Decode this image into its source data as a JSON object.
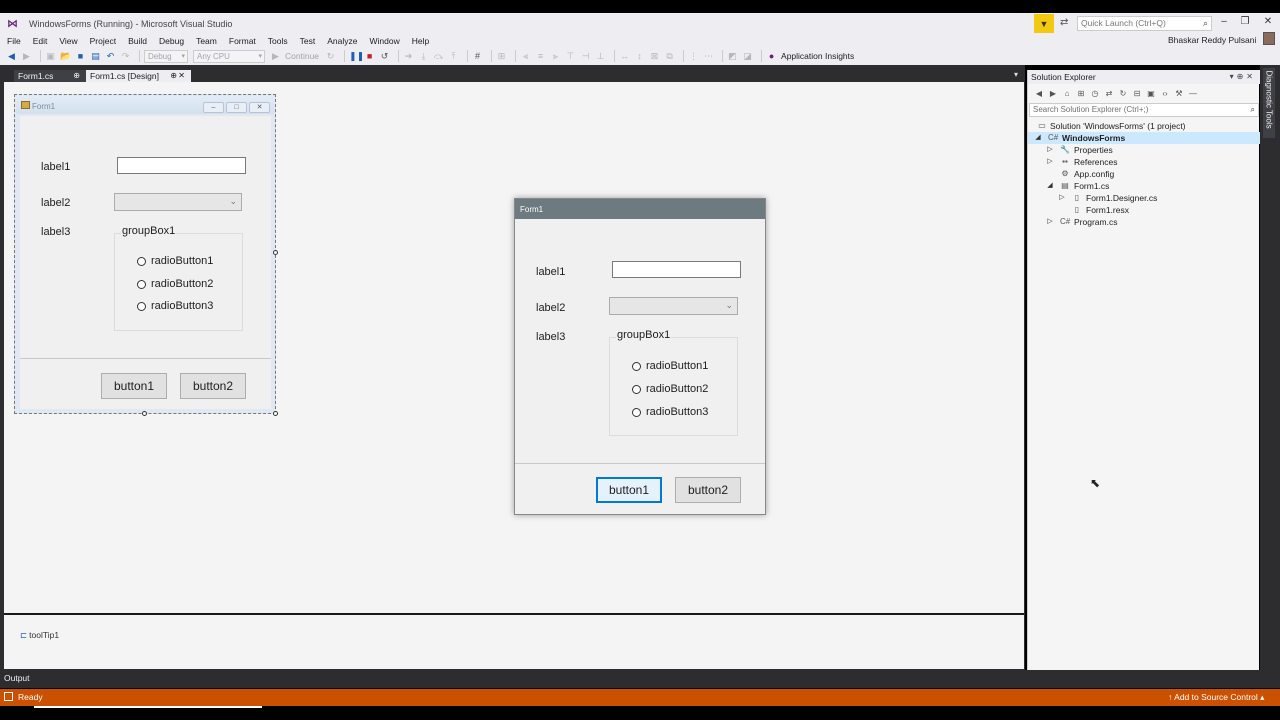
{
  "window": {
    "title": "WindowsForms (Running) - Microsoft Visual Studio",
    "quick_launch_placeholder": "Quick Launch (Ctrl+Q)",
    "user_name": "Bhaskar Reddy Pulsani"
  },
  "menu": [
    "File",
    "Edit",
    "View",
    "Project",
    "Build",
    "Debug",
    "Team",
    "Format",
    "Tools",
    "Test",
    "Analyze",
    "Window",
    "Help"
  ],
  "toolbar": {
    "config_combo": "Debug",
    "platform_combo": "Any CPU",
    "continue_label": "Continue",
    "app_insights_label": "Application Insights"
  },
  "tabs": [
    {
      "label": "Form1.cs",
      "pin": "⊕"
    },
    {
      "label": "Form1.cs [Design]",
      "pin": "⊕"
    }
  ],
  "design_form": {
    "title": "Form1",
    "label1": "label1",
    "label2": "label2",
    "label3": "label3",
    "group_caption": "groupBox1",
    "radio1": "radioButton1",
    "radio2": "radioButton2",
    "radio3": "radioButton3",
    "button1": "button1",
    "button2": "button2"
  },
  "running_form": {
    "title": "Form1",
    "label1": "label1",
    "label2": "label2",
    "label3": "label3",
    "group_caption": "groupBox1",
    "radio1": "radioButton1",
    "radio2": "radioButton2",
    "radio3": "radioButton3",
    "button1": "button1",
    "button2": "button2"
  },
  "component_tray": {
    "tooltip_item": "toolTip1"
  },
  "solution_explorer": {
    "title": "Solution Explorer",
    "search_placeholder": "Search Solution Explorer (Ctrl+;)",
    "tree": [
      {
        "label": "Solution 'WindowsForms' (1 project)",
        "level": 0,
        "expander": "",
        "icon": "solution-icon"
      },
      {
        "label": "WindowsForms",
        "level": 0,
        "expander": "◢",
        "icon": "csharp-project-icon"
      },
      {
        "label": "Properties",
        "level": 1,
        "expander": "▷",
        "icon": "wrench-icon"
      },
      {
        "label": "References",
        "level": 1,
        "expander": "▷",
        "icon": "references-icon"
      },
      {
        "label": "App.config",
        "level": 1,
        "expander": "",
        "icon": "config-file-icon"
      },
      {
        "label": "Form1.cs",
        "level": 1,
        "expander": "◢",
        "icon": "form-icon"
      },
      {
        "label": "Form1.Designer.cs",
        "level": 2,
        "expander": "▷",
        "icon": "cs-file-icon"
      },
      {
        "label": "Form1.resx",
        "level": 2,
        "expander": "",
        "icon": "resx-file-icon"
      },
      {
        "label": "Program.cs",
        "level": 1,
        "expander": "▷",
        "icon": "cs-file-icon"
      }
    ]
  },
  "diagnostic_tools_label": "Diagnostic Tools",
  "output_label": "Output",
  "status": {
    "left": "Ready",
    "right": "Add to Source Control"
  },
  "colors": {
    "status_bar": "#ca5100",
    "dark_chrome": "#2d2d30",
    "focus_blue": "#0078d7"
  }
}
